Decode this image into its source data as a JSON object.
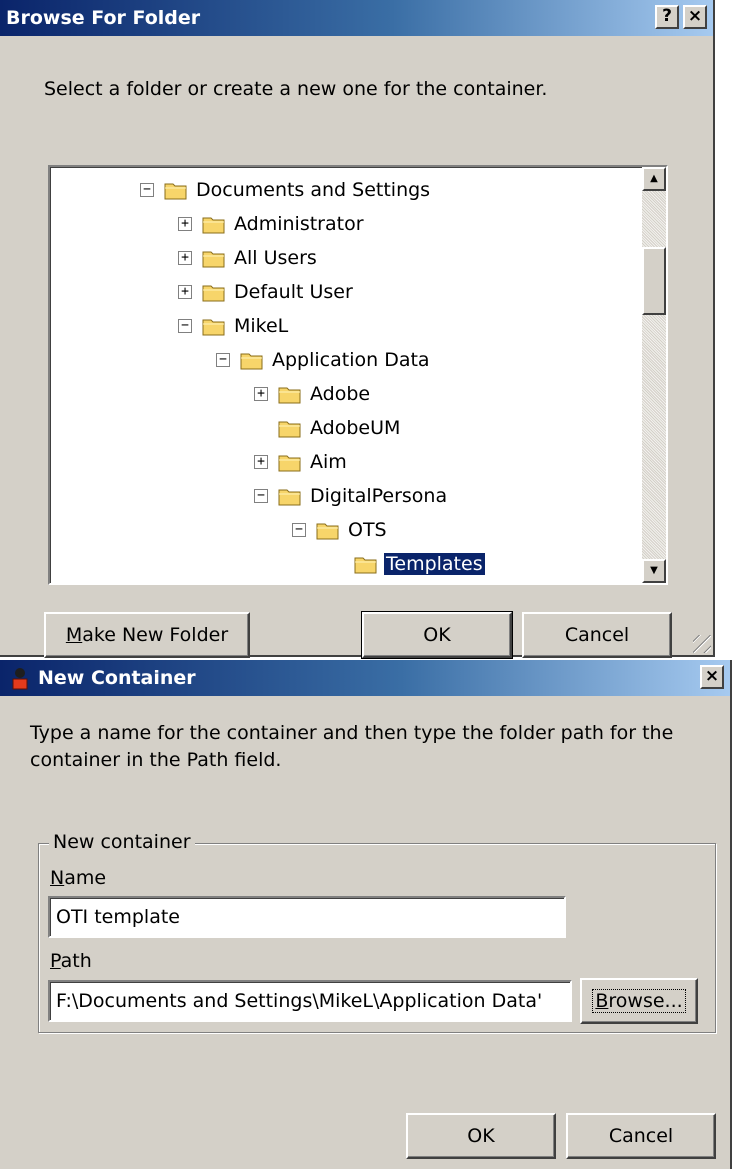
{
  "browse_dialog": {
    "title": "Browse For Folder",
    "help_button": "?",
    "close_button": "×",
    "instruction": "Select a folder or create a new one for the container.",
    "tree": [
      {
        "label": "Documents and Settings",
        "expander": "−",
        "level": 0
      },
      {
        "label": "Administrator",
        "expander": "+",
        "level": 1
      },
      {
        "label": "All Users",
        "expander": "+",
        "level": 1
      },
      {
        "label": "Default User",
        "expander": "+",
        "level": 1
      },
      {
        "label": "MikeL",
        "expander": "−",
        "level": 1
      },
      {
        "label": "Application Data",
        "expander": "−",
        "level": 2
      },
      {
        "label": "Adobe",
        "expander": "+",
        "level": 3
      },
      {
        "label": "AdobeUM",
        "expander": "",
        "level": 3
      },
      {
        "label": "Aim",
        "expander": "+",
        "level": 3
      },
      {
        "label": "DigitalPersona",
        "expander": "−",
        "level": 3
      },
      {
        "label": "OTS",
        "expander": "−",
        "level": 4
      },
      {
        "label": "Templates",
        "expander": "",
        "level": 5,
        "selected": true
      }
    ],
    "make_new_folder_mnemonic": "M",
    "make_new_folder_rest": "ake New Folder",
    "ok_label": "OK",
    "cancel_label": "Cancel"
  },
  "new_container_dialog": {
    "title": "New Container",
    "close_button": "×",
    "instruction": "Type a name for the container and then type the folder path for the container in the Path field.",
    "group_label": "New container",
    "name_mnemonic": "N",
    "name_rest": "ame",
    "name_value": "OTI template",
    "path_mnemonic": "P",
    "path_rest": "ath",
    "path_value": "F:\\Documents and Settings\\MikeL\\Application Data'",
    "browse_mnemonic": "B",
    "browse_rest": "rowse...",
    "ok_label": "OK",
    "cancel_label": "Cancel"
  },
  "colors": {
    "dialog_face": "#d4d0c8",
    "title_active": "#0a246a",
    "selection": "#0a246a",
    "folder_yellow": "#f7d56a"
  }
}
